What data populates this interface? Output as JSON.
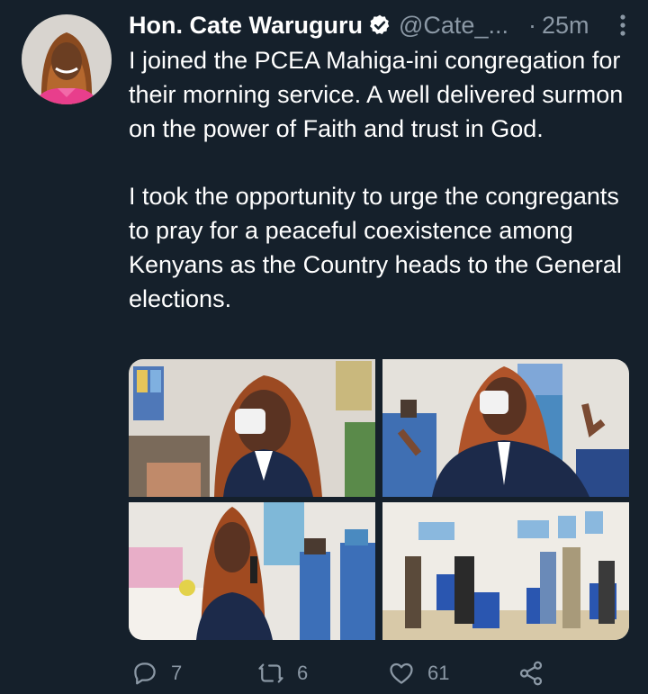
{
  "tweet": {
    "author_name": "Hon. Cate Waruguru",
    "handle": "@Cate_...",
    "separator": "·",
    "time": "25m",
    "paragraphs": [
      "I joined the PCEA Mahiga-ini congregation for their morning service. A well delivered surmon on the power of Faith and trust in God.",
      "I took the opportunity to urge the congregants to pray for a peaceful coexistence among Kenyans as the Country heads to the General elections."
    ],
    "reply_count": "7",
    "retweet_count": "6",
    "like_count": "61"
  },
  "icons": {
    "verified": "verified-badge-icon",
    "more": "more-vertical-icon",
    "reply": "reply-icon",
    "retweet": "retweet-icon",
    "like": "heart-icon",
    "share": "share-icon"
  },
  "colors": {
    "background": "#15202b",
    "text": "#ffffff",
    "secondary_text": "#8b98a5",
    "avatar_outfit": "#e83e8c"
  }
}
